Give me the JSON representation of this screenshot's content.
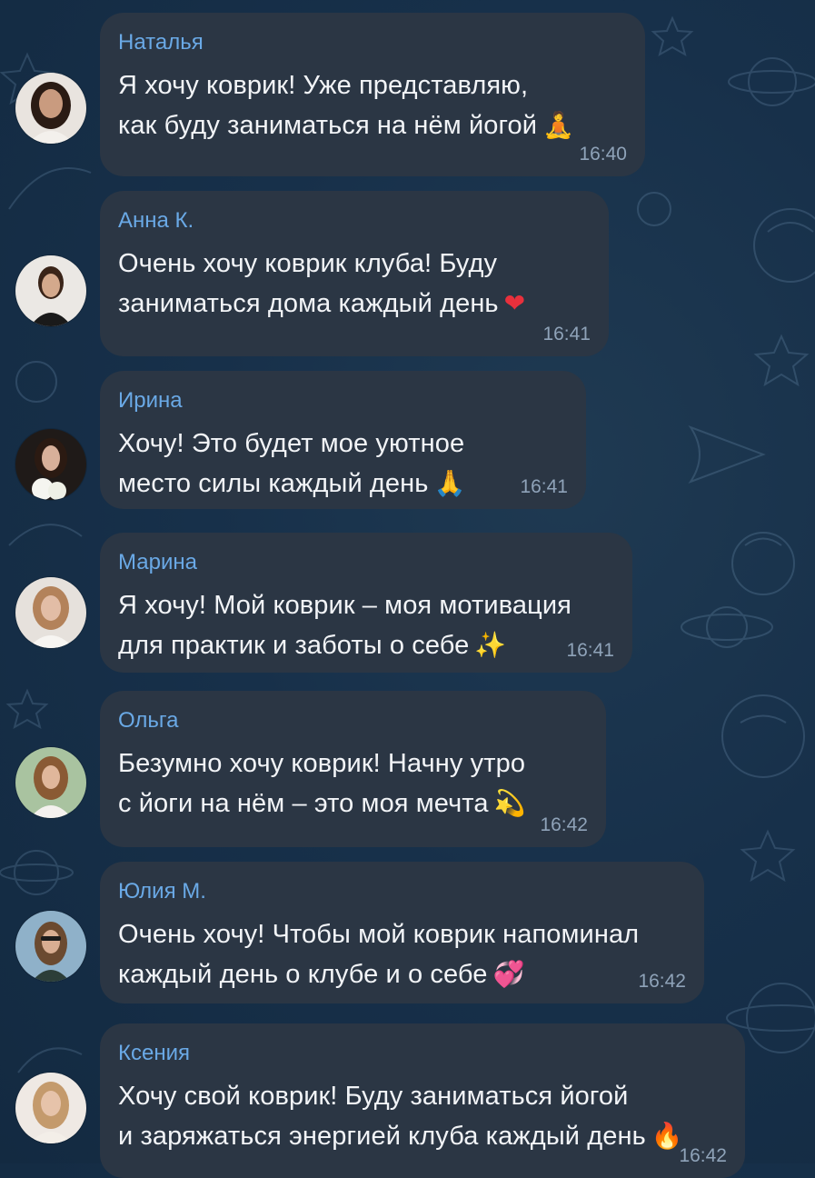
{
  "messages": [
    {
      "name": "Наталья",
      "text": "Я хочу коврик! Уже представляю,\nкак буду заниматься на нём йогой",
      "emoji": "🧘",
      "emoji_icon": "lotus-position-emoji",
      "time": "16:40"
    },
    {
      "name": "Анна К.",
      "text": "Очень хочу коврик клуба! Буду\nзаниматься дома каждый день",
      "emoji": "❤",
      "emoji_icon": "red-heart-emoji",
      "time": "16:41"
    },
    {
      "name": "Ирина",
      "text": "Хочу! Это будет мое уютное\nместо силы каждый день",
      "emoji": "🙏",
      "emoji_icon": "folded-hands-emoji",
      "time": "16:41"
    },
    {
      "name": "Марина",
      "text": "Я хочу! Мой коврик – моя мотивация\nдля практик и заботы о себе",
      "emoji": "✨",
      "emoji_icon": "sparkles-emoji",
      "time": "16:41"
    },
    {
      "name": "Ольга",
      "text": "Безумно хочу коврик! Начну утро\nс йоги на нём – это моя мечта",
      "emoji": "💫",
      "emoji_icon": "dizzy-emoji",
      "time": "16:42"
    },
    {
      "name": "Юлия М.",
      "text": "Очень хочу! Чтобы мой коврик напоминал\nкаждый день о клубе и о себе",
      "emoji": "💞",
      "emoji_icon": "revolving-hearts-emoji",
      "time": "16:42"
    },
    {
      "name": "Ксения",
      "text": "Хочу свой коврик! Буду заниматься йогой\nи заряжаться энергией клуба каждый день",
      "emoji": "🔥",
      "emoji_icon": "fire-emoji",
      "time": "16:42"
    }
  ],
  "colors": {
    "background": "#17304a",
    "bubble": "#2b3644",
    "name": "#6aa9e6",
    "text": "#f2f4f7",
    "time": "#8fa3b9"
  }
}
